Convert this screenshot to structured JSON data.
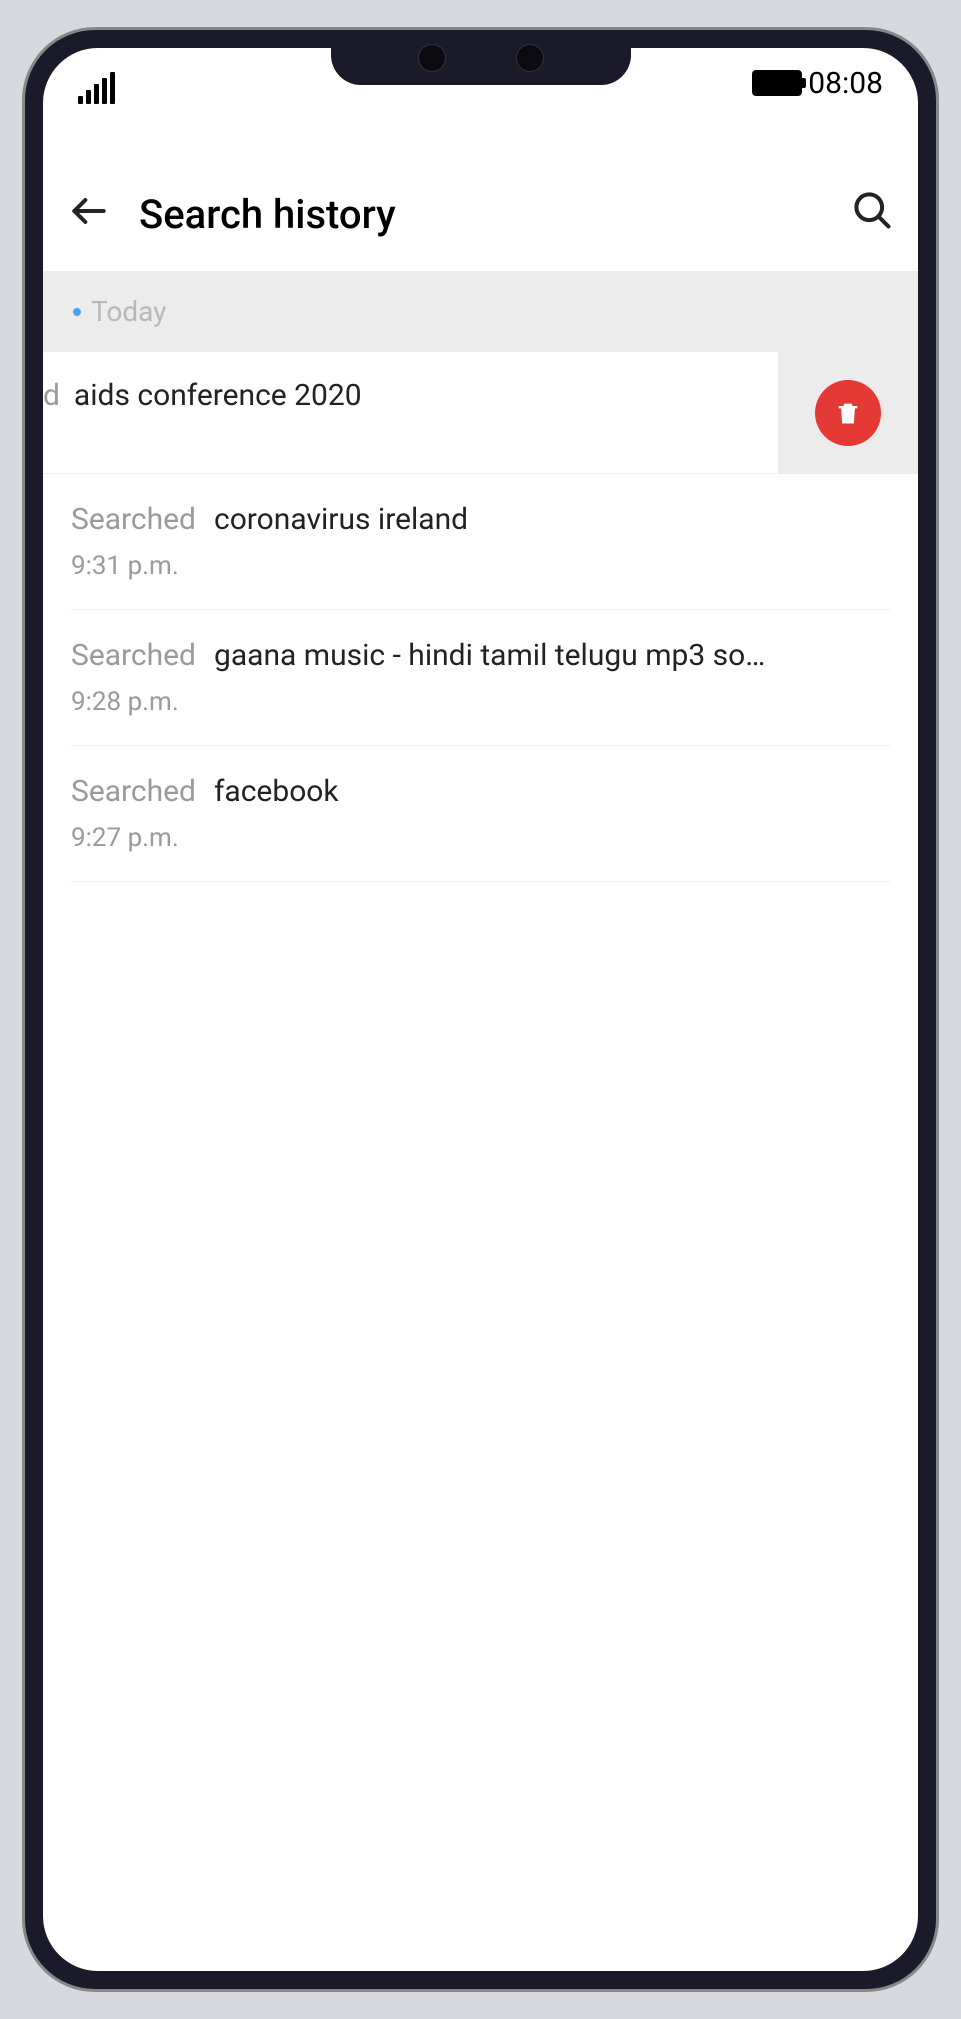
{
  "status": {
    "time": "08:08"
  },
  "header": {
    "title": "Search history"
  },
  "section": {
    "label": "Today"
  },
  "swiped": {
    "prefix": "d",
    "query": "aids conference 2020"
  },
  "rows": [
    {
      "label": "Searched",
      "query": "coronavirus ireland",
      "time": "9:31 p.m."
    },
    {
      "label": "Searched",
      "query": "gaana music - hindi tamil telugu mp3 son...",
      "time": "9:28 p.m."
    },
    {
      "label": "Searched",
      "query": "facebook",
      "time": "9:27 p.m."
    }
  ]
}
